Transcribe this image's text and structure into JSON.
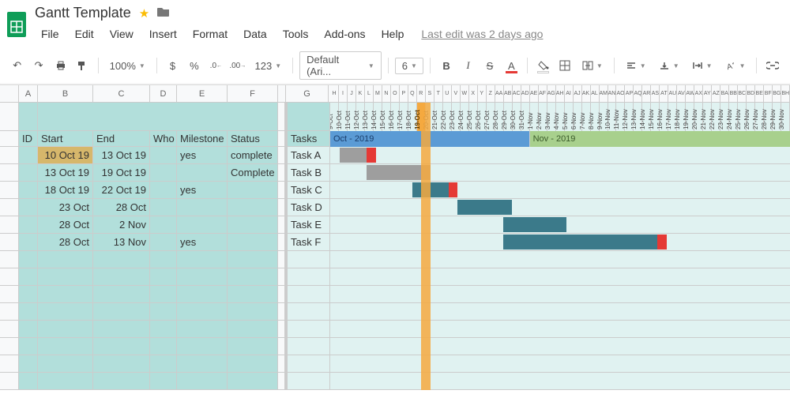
{
  "doc": {
    "title": "Gantt Template",
    "last_edit": "Last edit was 2 days ago"
  },
  "menu": [
    "File",
    "Edit",
    "View",
    "Insert",
    "Format",
    "Data",
    "Tools",
    "Add-ons",
    "Help"
  ],
  "toolbar": {
    "zoom": "100%",
    "currency": "$",
    "percent": "%",
    "dec_dec": ".0",
    "dec_inc": ".00",
    "more_fmt": "123",
    "font": "Default (Ari...",
    "size": "6",
    "bold": "B",
    "italic": "I",
    "strike": "S",
    "textcolor": "A"
  },
  "columns_left": [
    "A",
    "B",
    "C",
    "D",
    "E",
    "F",
    "",
    "G"
  ],
  "headers": {
    "id": "ID",
    "start": "Start",
    "end": "End",
    "who": "Who",
    "milestone": "Milestone",
    "status": "Status",
    "tasks": "Tasks"
  },
  "rows": [
    {
      "start": "10 Oct 19",
      "end": "13 Oct 19",
      "who": "",
      "milestone": "yes",
      "status": "complete",
      "task": "Task A"
    },
    {
      "start": "13 Oct 19",
      "end": "19 Oct 19",
      "who": "",
      "milestone": "",
      "status": "Complete",
      "task": "Task B"
    },
    {
      "start": "18 Oct 19",
      "end": "22 Oct 19",
      "who": "",
      "milestone": "yes",
      "status": "",
      "task": "Task C"
    },
    {
      "start": "23 Oct",
      "end": "28 Oct",
      "who": "",
      "milestone": "",
      "status": "",
      "task": "Task D"
    },
    {
      "start": "28 Oct",
      "end": "2 Nov",
      "who": "",
      "milestone": "",
      "status": "",
      "task": "Task E"
    },
    {
      "start": "28 Oct",
      "end": "13 Nov",
      "who": "",
      "milestone": "yes",
      "status": "",
      "task": "Task F"
    }
  ],
  "months": {
    "oct": "Oct - 2019",
    "nov": "Nov - 2019"
  },
  "chart_data": {
    "type": "gantt",
    "date_range_start": "2019-10-09",
    "date_range_end": "2019-11-30",
    "today": "2019-10-19",
    "dates": [
      "9-Oct",
      "10-Oct",
      "11-Oct",
      "12-Oct",
      "13-Oct",
      "14-Oct",
      "15-Oct",
      "16-Oct",
      "17-Oct",
      "18-Oct",
      "19-Oct",
      "20-Oct",
      "21-Oct",
      "22-Oct",
      "23-Oct",
      "24-Oct",
      "25-Oct",
      "26-Oct",
      "27-Oct",
      "28-Oct",
      "29-Oct",
      "30-Oct",
      "31-Oct",
      "1-Nov",
      "2-Nov",
      "3-Nov",
      "4-Nov",
      "5-Nov",
      "6-Nov",
      "7-Nov",
      "8-Nov",
      "9-Nov",
      "10-Nov",
      "11-Nov",
      "12-Nov",
      "13-Nov",
      "14-Nov",
      "15-Nov",
      "16-Nov",
      "17-Nov",
      "18-Nov",
      "19-Nov",
      "20-Nov",
      "21-Nov",
      "22-Nov",
      "23-Nov",
      "24-Nov",
      "25-Nov",
      "26-Nov",
      "27-Nov",
      "28-Nov",
      "29-Nov",
      "30-Nov"
    ],
    "tasks": [
      {
        "name": "Task A",
        "start": 1,
        "end": 4,
        "color": "grey",
        "milestone": true
      },
      {
        "name": "Task B",
        "start": 4,
        "end": 10,
        "color": "grey",
        "milestone": false
      },
      {
        "name": "Task C",
        "start": 9,
        "end": 13,
        "color": "teal",
        "milestone": true
      },
      {
        "name": "Task D",
        "start": 14,
        "end": 19,
        "color": "teal",
        "milestone": false
      },
      {
        "name": "Task E",
        "start": 19,
        "end": 25,
        "color": "teal",
        "milestone": false
      },
      {
        "name": "Task F",
        "start": 19,
        "end": 36,
        "color": "teal",
        "milestone": true
      }
    ]
  }
}
